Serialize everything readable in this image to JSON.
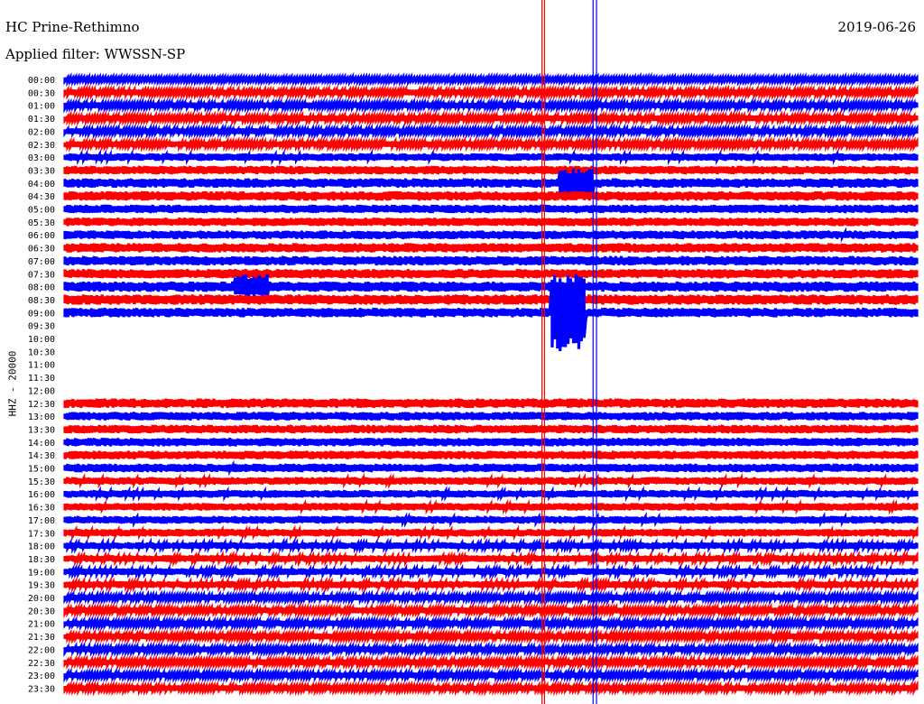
{
  "header": {
    "station": "HC Prine-Rethimno",
    "date": "2019-06-26",
    "filter_label": "Applied filter: WWSSN-SP"
  },
  "chart_data": {
    "type": "line",
    "title": "HC Prine-Rethimno",
    "subtitle": "Applied filter: WWSSN-SP",
    "ylabel": "HHZ - 20000",
    "xlabel": "",
    "row_labels": [
      "00:00",
      "00:30",
      "01:00",
      "01:30",
      "02:00",
      "02:30",
      "03:00",
      "03:30",
      "04:00",
      "04:30",
      "05:00",
      "05:30",
      "06:00",
      "06:30",
      "07:00",
      "07:30",
      "08:00",
      "08:30",
      "09:00",
      "09:30",
      "10:00",
      "10:30",
      "11:00",
      "11:30",
      "12:00",
      "12:30",
      "13:00",
      "13:30",
      "14:00",
      "14:30",
      "15:00",
      "15:30",
      "16:00",
      "16:30",
      "17:00",
      "17:30",
      "18:00",
      "18:30",
      "19:00",
      "19:30",
      "20:00",
      "20:30",
      "21:00",
      "21:30",
      "22:00",
      "22:30",
      "23:00",
      "23:30"
    ],
    "row_minutes": 30,
    "series_colors": [
      "#0000ff",
      "#ff0000"
    ],
    "noise_amplitude_by_row": [
      0.5,
      0.6,
      0.6,
      0.6,
      0.6,
      0.6,
      0.8,
      0.9,
      1.0,
      1.0,
      0.9,
      0.9,
      0.9,
      1.0,
      1.0,
      1.0,
      1.1,
      1.1,
      1.0,
      1.0,
      0,
      0,
      0,
      0,
      0,
      1.0,
      0.9,
      0.9,
      0.9,
      0.9,
      0.9,
      0.8,
      0.8,
      0.8,
      0.8,
      0.8,
      0.7,
      0.7,
      0.7,
      0.7,
      0.6,
      0.6,
      0.6,
      0.6,
      0.6,
      0.6,
      0.6,
      0.6
    ],
    "gaps": [
      {
        "rows": [
          19,
          24
        ],
        "note": "no data"
      },
      {
        "row": 24,
        "data_from_fraction": 0.875
      }
    ],
    "events": [
      {
        "row": 8,
        "at_fraction": 0.6,
        "amplitude": 3.5
      },
      {
        "row": 16,
        "at_fraction": 0.22,
        "amplitude": 2.5
      },
      {
        "row": 18,
        "at_fraction": 0.59,
        "amplitude": 9
      }
    ]
  },
  "colors": {
    "trace_a": "#0000ff",
    "trace_b": "#ff0000",
    "background": "#ffffff"
  }
}
